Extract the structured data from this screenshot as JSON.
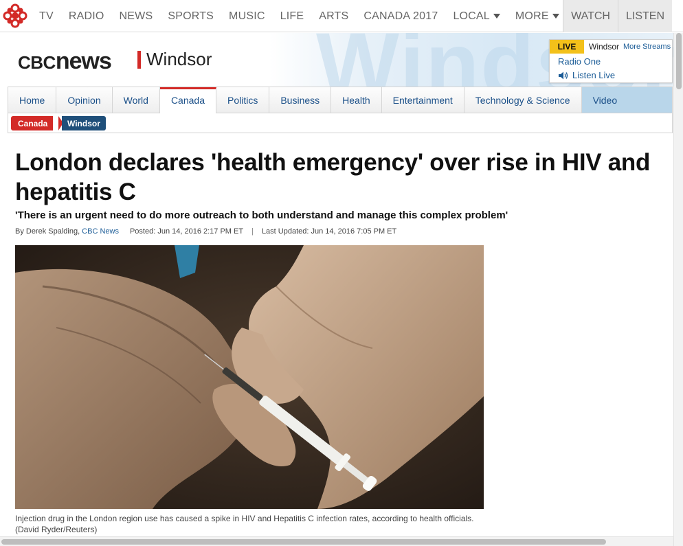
{
  "topnav": {
    "items": [
      {
        "label": "TV"
      },
      {
        "label": "RADIO"
      },
      {
        "label": "NEWS"
      },
      {
        "label": "SPORTS"
      },
      {
        "label": "MUSIC"
      },
      {
        "label": "LIFE"
      },
      {
        "label": "ARTS"
      },
      {
        "label": "CANADA 2017"
      },
      {
        "label": "LOCAL",
        "dropdown": true
      },
      {
        "label": "MORE",
        "dropdown": true
      }
    ],
    "watch": "WATCH",
    "listen": "LISTEN",
    "gem_icon": "cbc-gem-icon"
  },
  "header": {
    "logo_cbc": "CBC",
    "logo_news": "news",
    "region": "Windsor",
    "background_word": "Windsor",
    "accent_color": "#d32a27"
  },
  "livebox": {
    "badge": "LIVE",
    "station": "Windsor",
    "more": "More Streams",
    "radio": "Radio One",
    "listen": "Listen Live",
    "badge_color": "#f3c11a"
  },
  "sections": [
    {
      "label": "Home"
    },
    {
      "label": "Opinion"
    },
    {
      "label": "World"
    },
    {
      "label": "Canada",
      "active": true
    },
    {
      "label": "Politics"
    },
    {
      "label": "Business"
    },
    {
      "label": "Health"
    },
    {
      "label": "Entertainment"
    },
    {
      "label": "Technology & Science"
    },
    {
      "label": "Video"
    }
  ],
  "breadcrumb": {
    "parent": "Canada",
    "current": "Windsor"
  },
  "article": {
    "headline": "London declares 'health emergency' over rise in HIV and hepatitis C",
    "deck": "'There is an urgent need to do more outreach to both understand and manage this complex problem'",
    "byline_author": "By Derek Spalding,",
    "byline_org": "CBC News",
    "posted": "Posted: Jun 14, 2016 2:17 PM ET",
    "separator": "|",
    "updated": "Last Updated: Jun 14, 2016 7:05 PM ET",
    "caption_line1": "Injection drug in the London region use has caused a spike in HIV and Hepatitis C infection rates, according to health officials.",
    "caption_line2": "(David Ryder/Reuters)"
  }
}
